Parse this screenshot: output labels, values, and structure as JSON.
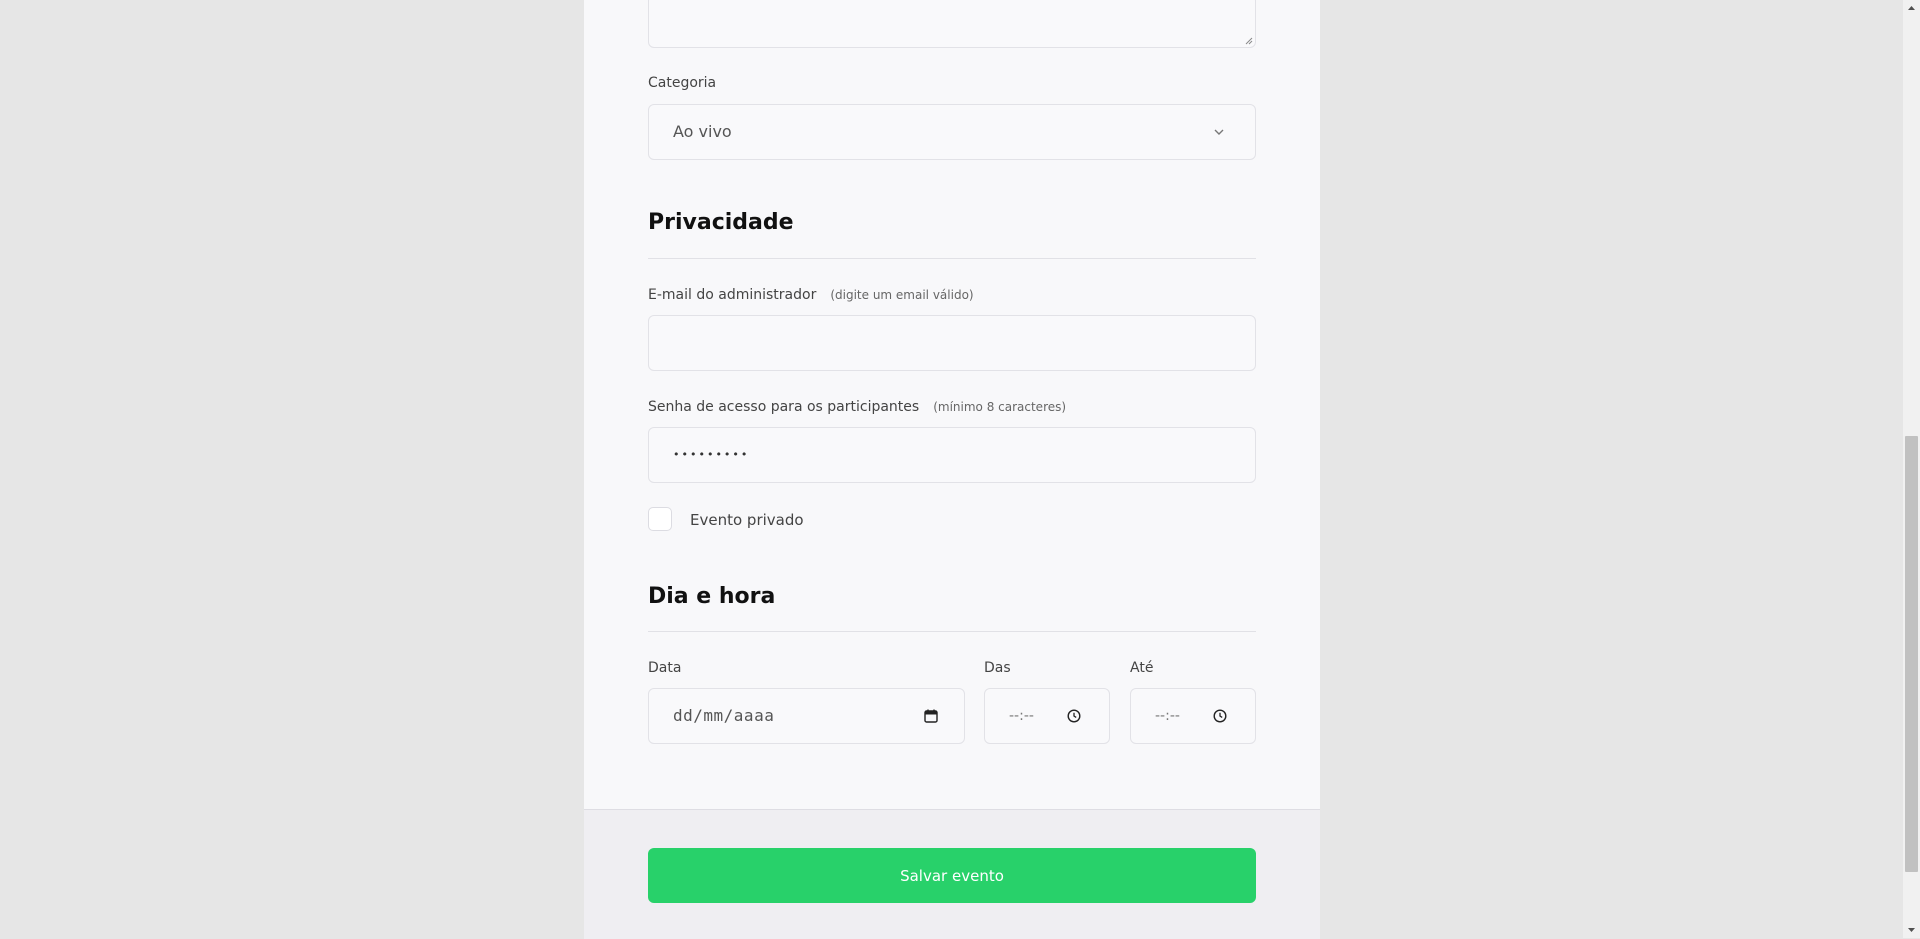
{
  "form": {
    "description": {
      "value": ""
    },
    "category": {
      "label": "Categoria",
      "selected": "Ao vivo"
    },
    "privacy": {
      "title": "Privacidade",
      "admin_email": {
        "label": "E-mail do administrador",
        "hint": "(digite um email válido)",
        "value": ""
      },
      "password": {
        "label": "Senha de acesso para os participantes",
        "hint": "(mínimo 8 caracteres)",
        "masked_value": "•••••••••"
      },
      "private_event": {
        "label": "Evento privado",
        "checked": false
      }
    },
    "datetime": {
      "title": "Dia e hora",
      "date": {
        "label": "Data",
        "placeholder": "dd/mm/aaaa"
      },
      "from": {
        "label": "Das",
        "placeholder": "--:--"
      },
      "to": {
        "label": "Até",
        "placeholder": "--:--"
      }
    }
  },
  "footer": {
    "save_label": "Salvar evento"
  },
  "colors": {
    "accent": "#28d16a",
    "page_bg": "#e6e6e6",
    "panel_bg": "#f8f8fa"
  },
  "icons": [
    "resize-grip-icon",
    "chevron-down-icon",
    "calendar-icon",
    "clock-icon"
  ]
}
